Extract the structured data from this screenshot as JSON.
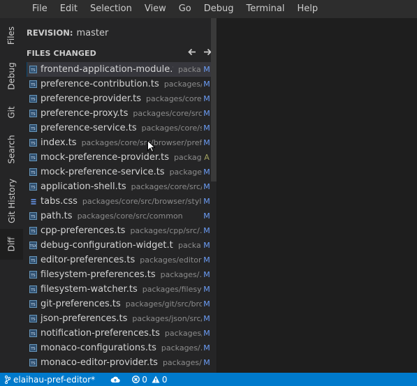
{
  "menu": [
    "File",
    "Edit",
    "Selection",
    "View",
    "Go",
    "Debug",
    "Terminal",
    "Help"
  ],
  "tabs": [
    "Files",
    "Debug",
    "Git",
    "Search",
    "Git History",
    "Diff"
  ],
  "revision": {
    "label": "REVISION:",
    "value": "master"
  },
  "files_changed": {
    "title": "FILES CHANGED"
  },
  "files": [
    {
      "name": "frontend-application-module.ts",
      "path": "packages/core/src/browser",
      "status": "M",
      "type": "ts"
    },
    {
      "name": "preference-contribution.ts",
      "path": "packages/core/src/browser",
      "status": "M",
      "type": "ts"
    },
    {
      "name": "preference-provider.ts",
      "path": "packages/core/src/browser",
      "status": "M",
      "type": "ts"
    },
    {
      "name": "preference-proxy.ts",
      "path": "packages/core/src/browser",
      "status": "M",
      "type": "ts"
    },
    {
      "name": "preference-service.ts",
      "path": "packages/core/src/browser",
      "status": "M",
      "type": "ts"
    },
    {
      "name": "index.ts",
      "path": "packages/core/src/browser/preferences",
      "status": "M",
      "type": "ts"
    },
    {
      "name": "mock-preference-provider.ts",
      "path": "packages/core/src/browser",
      "status": "A",
      "type": "ts"
    },
    {
      "name": "mock-preference-service.ts",
      "path": "packages/core/src/browser",
      "status": "M",
      "type": "ts"
    },
    {
      "name": "application-shell.ts",
      "path": "packages/core/src/browser",
      "status": "M",
      "type": "ts"
    },
    {
      "name": "tabs.css",
      "path": "packages/core/src/browser/style",
      "status": "M",
      "type": "css"
    },
    {
      "name": "path.ts",
      "path": "packages/core/src/common",
      "status": "M",
      "type": "ts"
    },
    {
      "name": "cpp-preferences.ts",
      "path": "packages/cpp/src/browser",
      "status": "M",
      "type": "ts"
    },
    {
      "name": "debug-configuration-widget.tsx",
      "path": "packages/debug/src/browser",
      "status": "M",
      "type": "tsx"
    },
    {
      "name": "editor-preferences.ts",
      "path": "packages/editor/src/browser",
      "status": "M",
      "type": "ts"
    },
    {
      "name": "filesystem-preferences.ts",
      "path": "packages/filesystem/src/browser",
      "status": "M",
      "type": "ts"
    },
    {
      "name": "filesystem-watcher.ts",
      "path": "packages/filesystem/src/browser",
      "status": "M",
      "type": "ts"
    },
    {
      "name": "git-preferences.ts",
      "path": "packages/git/src/browser",
      "status": "M",
      "type": "ts"
    },
    {
      "name": "json-preferences.ts",
      "path": "packages/json/src/browser",
      "status": "M",
      "type": "ts"
    },
    {
      "name": "notification-preferences.ts",
      "path": "packages/messages/src/browser",
      "status": "M",
      "type": "ts"
    },
    {
      "name": "monaco-configurations.ts",
      "path": "packages/monaco/src/browser",
      "status": "M",
      "type": "ts"
    },
    {
      "name": "monaco-editor-provider.ts",
      "path": "packages/monaco/src/browser",
      "status": "M",
      "type": "ts"
    }
  ],
  "status_bar": {
    "branch": "elaihau-pref-editor*",
    "errors": "0",
    "warnings": "0"
  },
  "colors": {
    "accent": "#007acc",
    "modified": "#6c9ef8",
    "added": "#a0a060",
    "ts_icon": "#6897bb"
  },
  "icons": {
    "branch": "git-branch-icon",
    "sync": "cloud-sync-icon",
    "error": "error-icon",
    "warning": "warning-icon"
  }
}
